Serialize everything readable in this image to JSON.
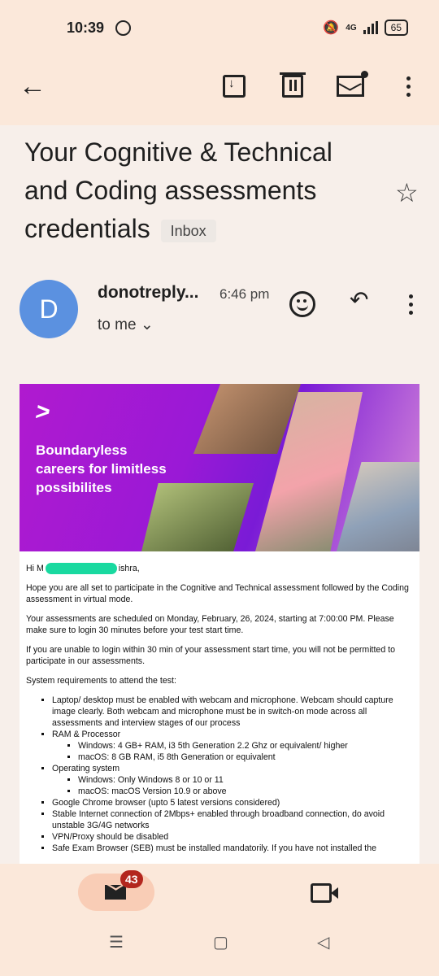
{
  "status": {
    "time": "10:39",
    "network": "4G",
    "battery": "65"
  },
  "toolbar": {
    "back": "←",
    "archive": "archive",
    "delete": "delete",
    "mark_unread": "mark unread",
    "more": "more"
  },
  "subject": {
    "title": "Your Cognitive & Technical and Coding assessments credentials",
    "label": "Inbox"
  },
  "sender": {
    "initial": "D",
    "name": "donotreply...",
    "time": "6:46 pm",
    "to": "to me"
  },
  "email": {
    "banner": {
      "brand": ">",
      "tagline": "Boundaryless careers for limitless possibilites"
    },
    "greeting_start": "Hi M",
    "greeting_end": "ishra,",
    "p1": "Hope you are all set to participate in the Cognitive and Technical assessment followed by the Coding assessment in virtual mode.",
    "p2": "Your assessments are scheduled on Monday, February, 26, 2024, starting at 7:00:00 PM. Please make sure to login 30 minutes before your test start time.",
    "p3": "If you are unable to login within 30 min of your assessment start time, you will not be permitted to participate in our assessments.",
    "sysreq": "System requirements to attend the test:",
    "req": [
      "Laptop/ desktop must be enabled with webcam and microphone. Webcam should capture image clearly. Both webcam and microphone must be in switch-on mode across all assessments and interview stages of our process",
      "RAM & Processor",
      "Windows: 4 GB+ RAM, i3 5th Generation 2.2 Ghz or equivalent/ higher",
      "macOS: 8 GB RAM, i5 8th Generation or equivalent",
      "Operating system",
      "Windows: Only Windows 8 or 10 or 11",
      "macOS: macOS Version 10.9 or above",
      "Google Chrome browser (upto 5 latest versions considered)",
      "Stable Internet connection of 2Mbps+ enabled through broadband connection, do avoid unstable 3G/4G networks",
      "VPN/Proxy should be disabled",
      "Safe Exam Browser (SEB) must be installed mandatorily. If you have not installed the"
    ]
  },
  "bottom": {
    "mail_count": "43"
  }
}
